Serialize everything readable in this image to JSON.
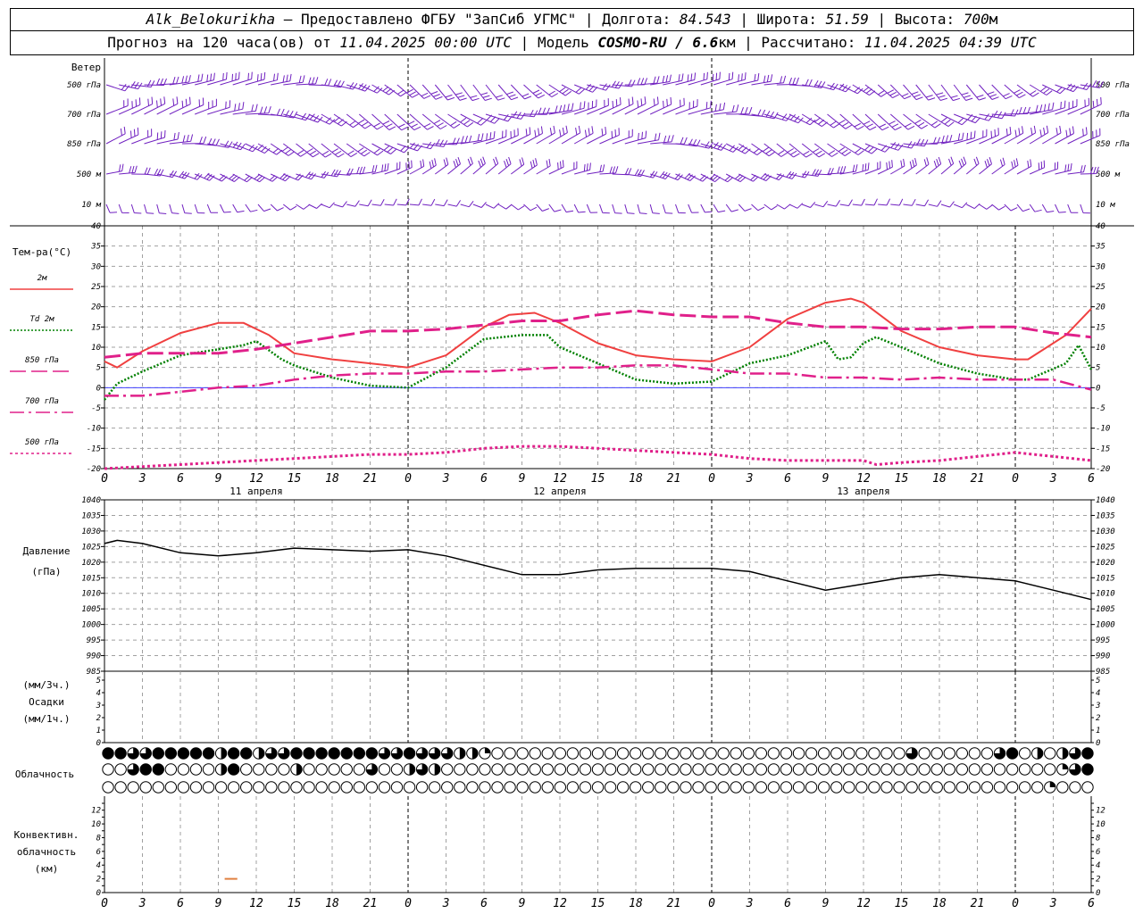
{
  "header": {
    "station": "Alk_Belokurikha",
    "provided": "– Предоставлено ФГБУ \"ЗапСиб УГМС\"",
    "lon_label": "Долгота:",
    "lon": "84.543",
    "lat_label": "Широта:",
    "lat": "51.59",
    "alt_label": "Высота:",
    "alt": "700",
    "alt_unit": "м",
    "forecast_label": "Прогноз на 120 часа(ов) от",
    "start": "11.04.2025 00:00 UTC",
    "model_label": "Модель",
    "model": "COSMO-RU / 6.6",
    "model_unit": "км",
    "calc_label": "Рассчитано:",
    "calc": "11.04.2025 04:39 UTC"
  },
  "chart_data": [
    {
      "type": "wind-barbs",
      "label": "Ветер",
      "levels": [
        "500 гПа",
        "700 гПа",
        "850 гПа",
        "500 м",
        "10 м"
      ]
    },
    {
      "type": "line",
      "ylabel": "Тем-ра(°C)",
      "ylim": [
        -20,
        40
      ],
      "yticks": [
        -20,
        -15,
        -10,
        -5,
        0,
        5,
        10,
        15,
        20,
        25,
        30,
        35,
        40
      ],
      "x_hours": [
        0,
        3,
        6,
        9,
        12,
        15,
        18,
        21,
        24,
        27,
        30,
        33,
        36,
        39,
        42,
        45,
        48,
        51,
        54,
        57,
        60,
        63,
        66,
        69,
        72,
        75
      ],
      "xtick_labels": [
        "0",
        "3",
        "6",
        "9",
        "12",
        "15",
        "18",
        "21",
        "0",
        "3",
        "6",
        "9",
        "12",
        "15",
        "18",
        "21",
        "0",
        "3",
        "6",
        "9",
        "12",
        "15",
        "18",
        "21",
        "0",
        "3",
        "6"
      ],
      "day_labels": [
        "11 апреля",
        "12 апреля",
        "13 апреля"
      ],
      "series": [
        {
          "name": "2м",
          "color": "#f04040",
          "style": "solid",
          "x": [
            0,
            1,
            3,
            6,
            9,
            11,
            13,
            15,
            18,
            21,
            24,
            27,
            30,
            32,
            34,
            36,
            39,
            42,
            45,
            48,
            51,
            54,
            57,
            59,
            60,
            63,
            66,
            69,
            72,
            73,
            76,
            78
          ],
          "values": [
            6.5,
            5,
            9,
            13.5,
            16,
            16,
            13,
            8.5,
            7,
            6,
            5,
            8,
            15,
            18,
            18.5,
            16,
            11,
            8,
            7,
            6.5,
            10,
            17,
            21,
            22,
            21,
            14,
            10,
            8,
            7,
            7,
            13,
            19.5
          ]
        },
        {
          "name": "Td 2м",
          "color": "#008000",
          "style": "dot",
          "x": [
            0,
            1,
            3,
            6,
            9,
            11,
            12,
            14,
            15,
            18,
            21,
            24,
            27,
            30,
            33,
            35,
            36,
            39,
            42,
            45,
            48,
            51,
            54,
            57,
            58,
            59,
            60,
            61,
            63,
            66,
            69,
            72,
            73,
            76,
            77,
            78
          ],
          "values": [
            -3,
            1,
            4,
            8,
            9.5,
            10.5,
            11.5,
            7,
            5.5,
            2.5,
            0.5,
            0,
            5,
            12,
            13,
            13,
            10,
            6,
            2,
            1,
            1.5,
            6,
            8,
            11.5,
            7,
            7.5,
            11,
            12.5,
            10,
            6,
            3.5,
            2,
            2,
            6,
            10.5,
            4.5
          ]
        },
        {
          "name": "850 гПа",
          "color": "#e0208a",
          "style": "longdash",
          "x": [
            0,
            3,
            6,
            9,
            12,
            15,
            18,
            21,
            24,
            27,
            30,
            33,
            36,
            39,
            42,
            45,
            48,
            51,
            54,
            57,
            60,
            63,
            66,
            69,
            72,
            75,
            78
          ],
          "values": [
            7.5,
            8.5,
            8.5,
            8.5,
            9.5,
            11,
            12.5,
            14,
            14,
            14.5,
            15.5,
            16.5,
            16.5,
            18,
            19,
            18,
            17.5,
            17.5,
            16,
            15,
            15,
            14.5,
            14.5,
            15,
            15,
            13.5,
            12.5
          ]
        },
        {
          "name": "700 гПа",
          "color": "#e0208a",
          "style": "dashdot",
          "x": [
            0,
            3,
            6,
            9,
            12,
            15,
            18,
            21,
            24,
            27,
            30,
            33,
            36,
            39,
            42,
            45,
            48,
            51,
            54,
            57,
            60,
            63,
            66,
            69,
            72,
            75,
            78
          ],
          "values": [
            -2,
            -2,
            -1,
            0,
            0.5,
            2,
            3,
            3.5,
            3.5,
            4,
            4,
            4.5,
            5,
            5,
            5.5,
            5.5,
            4.5,
            3.5,
            3.5,
            2.5,
            2.5,
            2,
            2.5,
            2,
            2,
            2,
            -0.5
          ]
        },
        {
          "name": "500 гПа",
          "color": "#e0208a",
          "style": "shortdash",
          "x": [
            0,
            3,
            6,
            9,
            12,
            15,
            18,
            21,
            24,
            27,
            30,
            33,
            36,
            39,
            42,
            45,
            48,
            51,
            54,
            57,
            60,
            61,
            63,
            66,
            69,
            72,
            75,
            78
          ],
          "values": [
            -20,
            -19.5,
            -19,
            -18.5,
            -18,
            -17.5,
            -17,
            -16.5,
            -16.5,
            -16,
            -15,
            -14.5,
            -14.5,
            -15,
            -15.5,
            -16,
            -16.5,
            -17.5,
            -18,
            -18,
            -18,
            -19,
            -18.5,
            -18,
            -17,
            -16,
            -17,
            -18
          ]
        }
      ]
    },
    {
      "type": "line",
      "ylabel": "Давление",
      "ylabel2": "(гПа)",
      "ylim": [
        985,
        1040
      ],
      "yticks": [
        985,
        990,
        995,
        1000,
        1005,
        1010,
        1015,
        1020,
        1025,
        1030,
        1035,
        1040
      ],
      "series": [
        {
          "name": "",
          "color": "#000000",
          "style": "solid",
          "x": [
            0,
            1,
            3,
            6,
            9,
            12,
            15,
            18,
            21,
            24,
            27,
            30,
            33,
            36,
            39,
            42,
            45,
            48,
            51,
            54,
            57,
            60,
            63,
            66,
            69,
            72,
            75,
            78
          ],
          "values": [
            1026,
            1027,
            1026,
            1023,
            1022,
            1023,
            1024.5,
            1024,
            1023.5,
            1024,
            1022,
            1019,
            1016,
            1016,
            1017.5,
            1018,
            1018,
            1018,
            1017,
            1014,
            1011,
            1013,
            1015,
            1016,
            1015,
            1014,
            1011,
            1008
          ]
        }
      ]
    },
    {
      "type": "bar",
      "ylabel_top": "(мм/3ч.)",
      "ylabel": "Осадки",
      "ylabel_bottom": "(мм/1ч.)",
      "ylim": [
        0,
        5
      ],
      "yticks": [
        0,
        1,
        2,
        3,
        4,
        5
      ],
      "values": []
    },
    {
      "type": "cloud-cover",
      "label": "Облачность",
      "count_per_row": 79,
      "rows": [
        "44334444424423344444443343332210000000000000000000000000000000003000000340202344444",
        "00344000024000020000030023200000000000000000000000000000000000000000000000001344",
        "0000000000000000000000000000000000000000000000000000000000000000000000000001"
      ]
    },
    {
      "type": "bar",
      "ylabel": "Конвективн.",
      "ylabel2": "облачность",
      "ylabel3": "(км)",
      "ylim": [
        0,
        13
      ],
      "yticks": [
        0,
        1,
        2,
        3,
        4,
        5,
        6,
        7,
        8,
        9,
        10,
        11,
        12,
        13
      ],
      "ytick_labels": [
        "0",
        "2",
        "4",
        "6",
        "8",
        "10",
        "12"
      ],
      "color": "#e08040",
      "segments": [
        {
          "x0": 9.5,
          "x1": 10.5,
          "value": 2
        }
      ]
    }
  ]
}
